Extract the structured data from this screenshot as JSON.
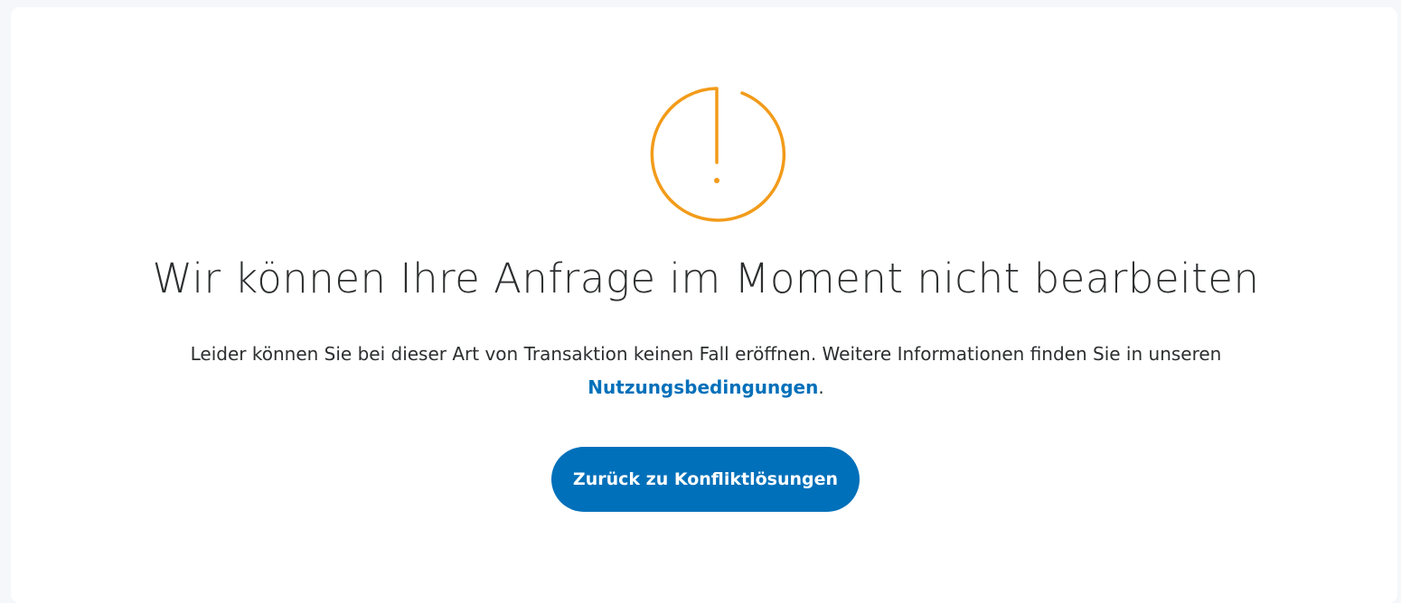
{
  "error": {
    "icon": "exclamation-circle-icon",
    "icon_color": "#f29b1a",
    "title": "Wir können Ihre Anfrage im Moment nicht bearbeiten",
    "message_line1": "Leider können Sie bei dieser Art von Transaktion keinen Fall eröffnen. Weitere Informationen finden Sie in unseren",
    "link_text": "Nutzungsbedingungen",
    "message_end": ".",
    "link_color": "#0070ba"
  },
  "action": {
    "button_label": "Zurück zu Konfliktlösungen",
    "button_color": "#0070ba"
  }
}
